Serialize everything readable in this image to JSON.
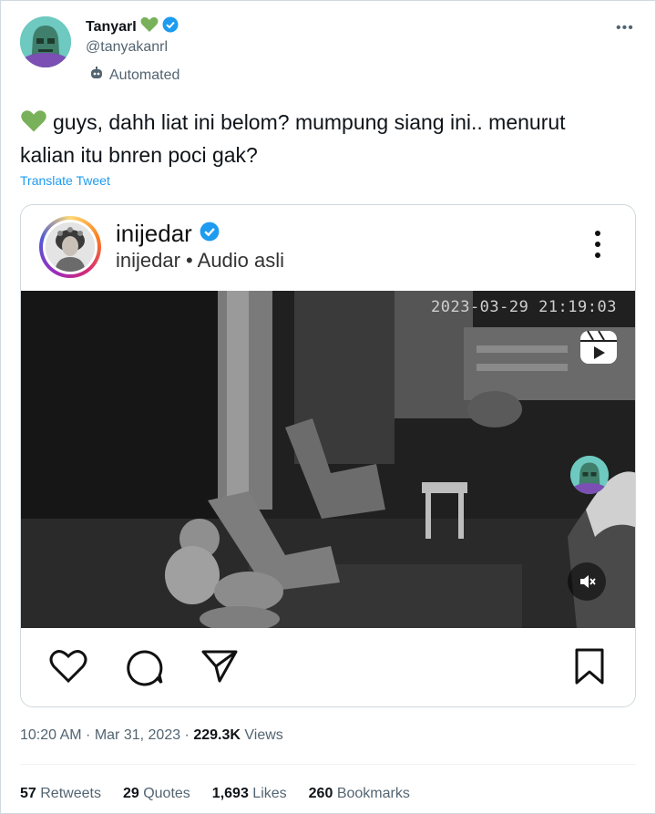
{
  "author": {
    "display_name": "TanyarI",
    "handle": "@tanyakanrl",
    "label": "Automated"
  },
  "tweet": {
    "text": "guys, dahh liat ini belom? mumpung siang ini.. menurut kalian itu bnren poci gak?",
    "translate_label": "Translate Tweet"
  },
  "embed": {
    "username": "inijedar",
    "subtitle": "inijedar • Audio asli",
    "video_timestamp": "2023-03-29  21:19:03"
  },
  "meta": {
    "time": "10:20 AM",
    "date": "Mar 31, 2023",
    "views_count": "229.3K",
    "views_label": "Views"
  },
  "stats": {
    "retweets_count": "57",
    "retweets_label": "Retweets",
    "quotes_count": "29",
    "quotes_label": "Quotes",
    "likes_count": "1,693",
    "likes_label": "Likes",
    "bookmarks_count": "260",
    "bookmarks_label": "Bookmarks"
  },
  "colors": {
    "link_blue": "#1d9bf0",
    "verified_blue": "#1d9bf0",
    "heart_green": "#78b159",
    "secondary_text": "#536471"
  },
  "icons": [
    "green-heart-icon",
    "verified-badge-icon",
    "robot-icon",
    "more-icon",
    "reels-icon",
    "mute-icon",
    "like-icon",
    "comment-icon",
    "share-icon",
    "save-icon"
  ]
}
